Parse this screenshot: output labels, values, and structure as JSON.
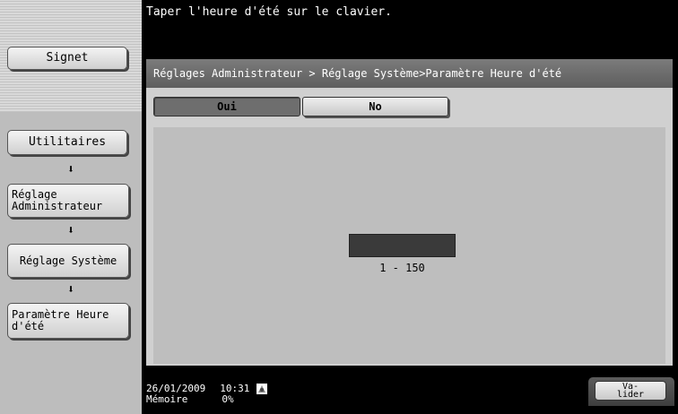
{
  "message": "Taper l'heure d'été sur le clavier.",
  "sidebar": {
    "bookmark_label": "Signet",
    "items": [
      {
        "label": "Utilitaires"
      },
      {
        "label": "Réglage\nAdministrateur"
      },
      {
        "label": "Réglage Système"
      },
      {
        "label": "Paramètre Heure\nd'été"
      }
    ],
    "arrow_glyph": "⬇"
  },
  "panel": {
    "breadcrumb": "Réglages Administrateur > Réglage Système>Paramètre Heure d'été",
    "tabs": [
      {
        "label": "Oui",
        "selected": true
      },
      {
        "label": "No",
        "selected": false
      }
    ],
    "value_input": {
      "value": "",
      "range_text": "1  -  150"
    }
  },
  "footer": {
    "date": "26/01/2009",
    "time": "10:31",
    "memory_label": "Mémoire",
    "memory_value": "0%",
    "network_icon": "network-status-icon"
  },
  "valider_label": "Va-\nlider"
}
